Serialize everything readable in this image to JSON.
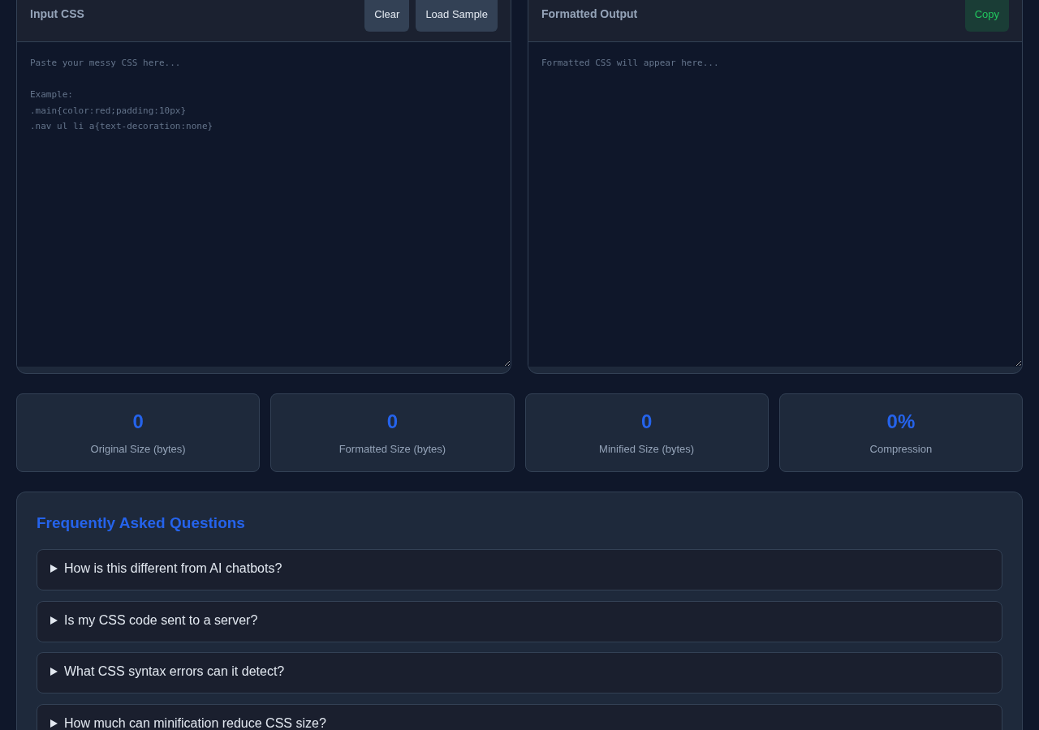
{
  "panels": [
    {
      "title": "Input CSS",
      "buttons": [
        {
          "label": "Clear",
          "kind": "neutral"
        },
        {
          "label": "Load Sample",
          "kind": "neutral"
        }
      ],
      "editor": {
        "placeholder": "Paste your messy CSS here...\n\nExample:\n.main{color:red;padding:10px}\n.nav ul li a{text-decoration:none}"
      }
    },
    {
      "title": "Formatted Output",
      "buttons": [
        {
          "label": "Copy",
          "kind": "success"
        }
      ],
      "editor": {
        "placeholder": "Formatted CSS will appear here..."
      }
    }
  ],
  "stats": [
    {
      "value": "0",
      "label": "Original Size (bytes)"
    },
    {
      "value": "0",
      "label": "Formatted Size (bytes)"
    },
    {
      "value": "0",
      "label": "Minified Size (bytes)"
    },
    {
      "value": "0%",
      "label": "Compression"
    }
  ],
  "faq": {
    "title": "Frequently Asked Questions",
    "items": [
      {
        "question": "How is this different from AI chatbots?",
        "expanded": false
      },
      {
        "question": "Is my CSS code sent to a server?",
        "expanded": false
      },
      {
        "question": "What CSS syntax errors can it detect?",
        "expanded": false
      },
      {
        "question": "How much can minification reduce CSS size?",
        "expanded": false
      }
    ]
  }
}
